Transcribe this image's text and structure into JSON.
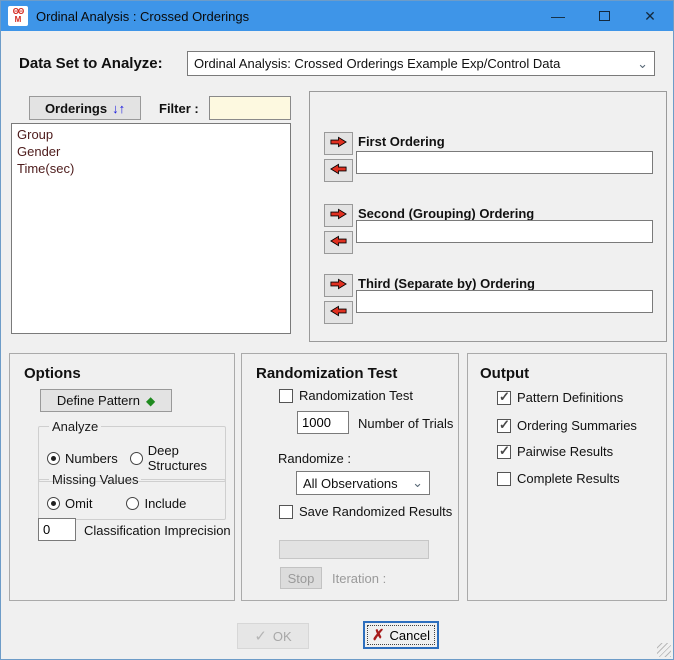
{
  "window": {
    "title": "Ordinal Analysis : Crossed Orderings",
    "icon_line1": "ΘΘ",
    "icon_line2": "M",
    "controls": {
      "minimize": "—",
      "close": "✕"
    }
  },
  "dataset": {
    "label": "Data Set to Analyze:",
    "value": "Ordinal Analysis: Crossed Orderings Example Exp/Control Data"
  },
  "orderings_panel": {
    "button_label": "Orderings",
    "button_arrows": "↓↑",
    "filter_label": "Filter :",
    "filter_value": "",
    "items": [
      "Group",
      "Gender",
      "Time(sec)"
    ]
  },
  "target_orderings": [
    {
      "label": "First Ordering",
      "value": ""
    },
    {
      "label": "Second (Grouping) Ordering",
      "value": ""
    },
    {
      "label": "Third (Separate by) Ordering",
      "value": ""
    }
  ],
  "options": {
    "heading": "Options",
    "define_pattern_label": "Define Pattern",
    "diamond_icon": "◆",
    "analyze": {
      "legend": "Analyze",
      "options": [
        {
          "label": "Numbers",
          "selected": true
        },
        {
          "label": "Deep Structures",
          "selected": false
        }
      ]
    },
    "missing_values": {
      "legend": "Missing Values",
      "options": [
        {
          "label": "Omit",
          "selected": true
        },
        {
          "label": "Include",
          "selected": false
        }
      ]
    },
    "classification": {
      "value": "0",
      "label": "Classification Imprecision"
    }
  },
  "randomization": {
    "heading": "Randomization Test",
    "checkbox_label": "Randomization Test",
    "checkbox_checked": false,
    "trials_value": "1000",
    "trials_label": "Number of Trials",
    "randomize_label": "Randomize :",
    "randomize_value": "All Observations",
    "save_label": "Save Randomized Results",
    "save_checked": false,
    "stop_label": "Stop",
    "iteration_label": "Iteration :"
  },
  "output": {
    "heading": "Output",
    "options": [
      {
        "label": "Pattern Definitions",
        "checked": true
      },
      {
        "label": "Ordering Summaries",
        "checked": true
      },
      {
        "label": "Pairwise Results",
        "checked": true
      },
      {
        "label": "Complete Results",
        "checked": false
      }
    ]
  },
  "footer": {
    "ok_label": "OK",
    "ok_icon": "✓",
    "cancel_label": "Cancel",
    "cancel_icon": "✗"
  },
  "icons": {
    "chevron": "⌄"
  },
  "colors": {
    "titlebar": "#3e95e8",
    "arrow_red": "#e03020",
    "diamond_green": "#1f8a1f",
    "filter_bg": "#fdf9e0",
    "cancel_x_red": "#a61c1c"
  }
}
